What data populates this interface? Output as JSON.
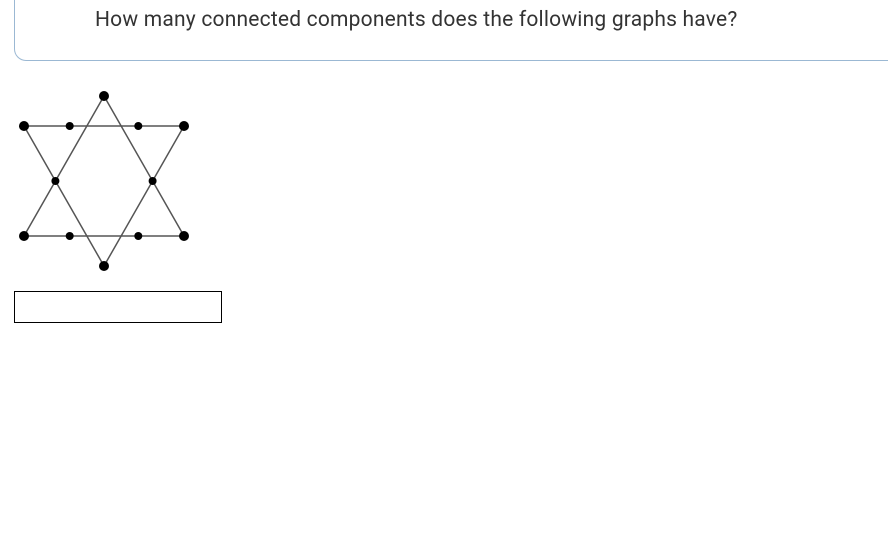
{
  "question": {
    "text": "How many connected components does the following graphs have?"
  },
  "answer": {
    "value": ""
  },
  "chart_data": {
    "type": "diagram",
    "description": "Star of David graph: two overlapping equilateral triangles forming a hexagram",
    "vertices": 12,
    "edges": 6,
    "triangles": [
      {
        "name": "upward",
        "vertices": [
          "top",
          "bottom-left",
          "bottom-right"
        ]
      },
      {
        "name": "downward",
        "vertices": [
          "bottom",
          "top-left",
          "top-right"
        ]
      }
    ],
    "note": "Outer points and intersection points shown as black dots"
  }
}
